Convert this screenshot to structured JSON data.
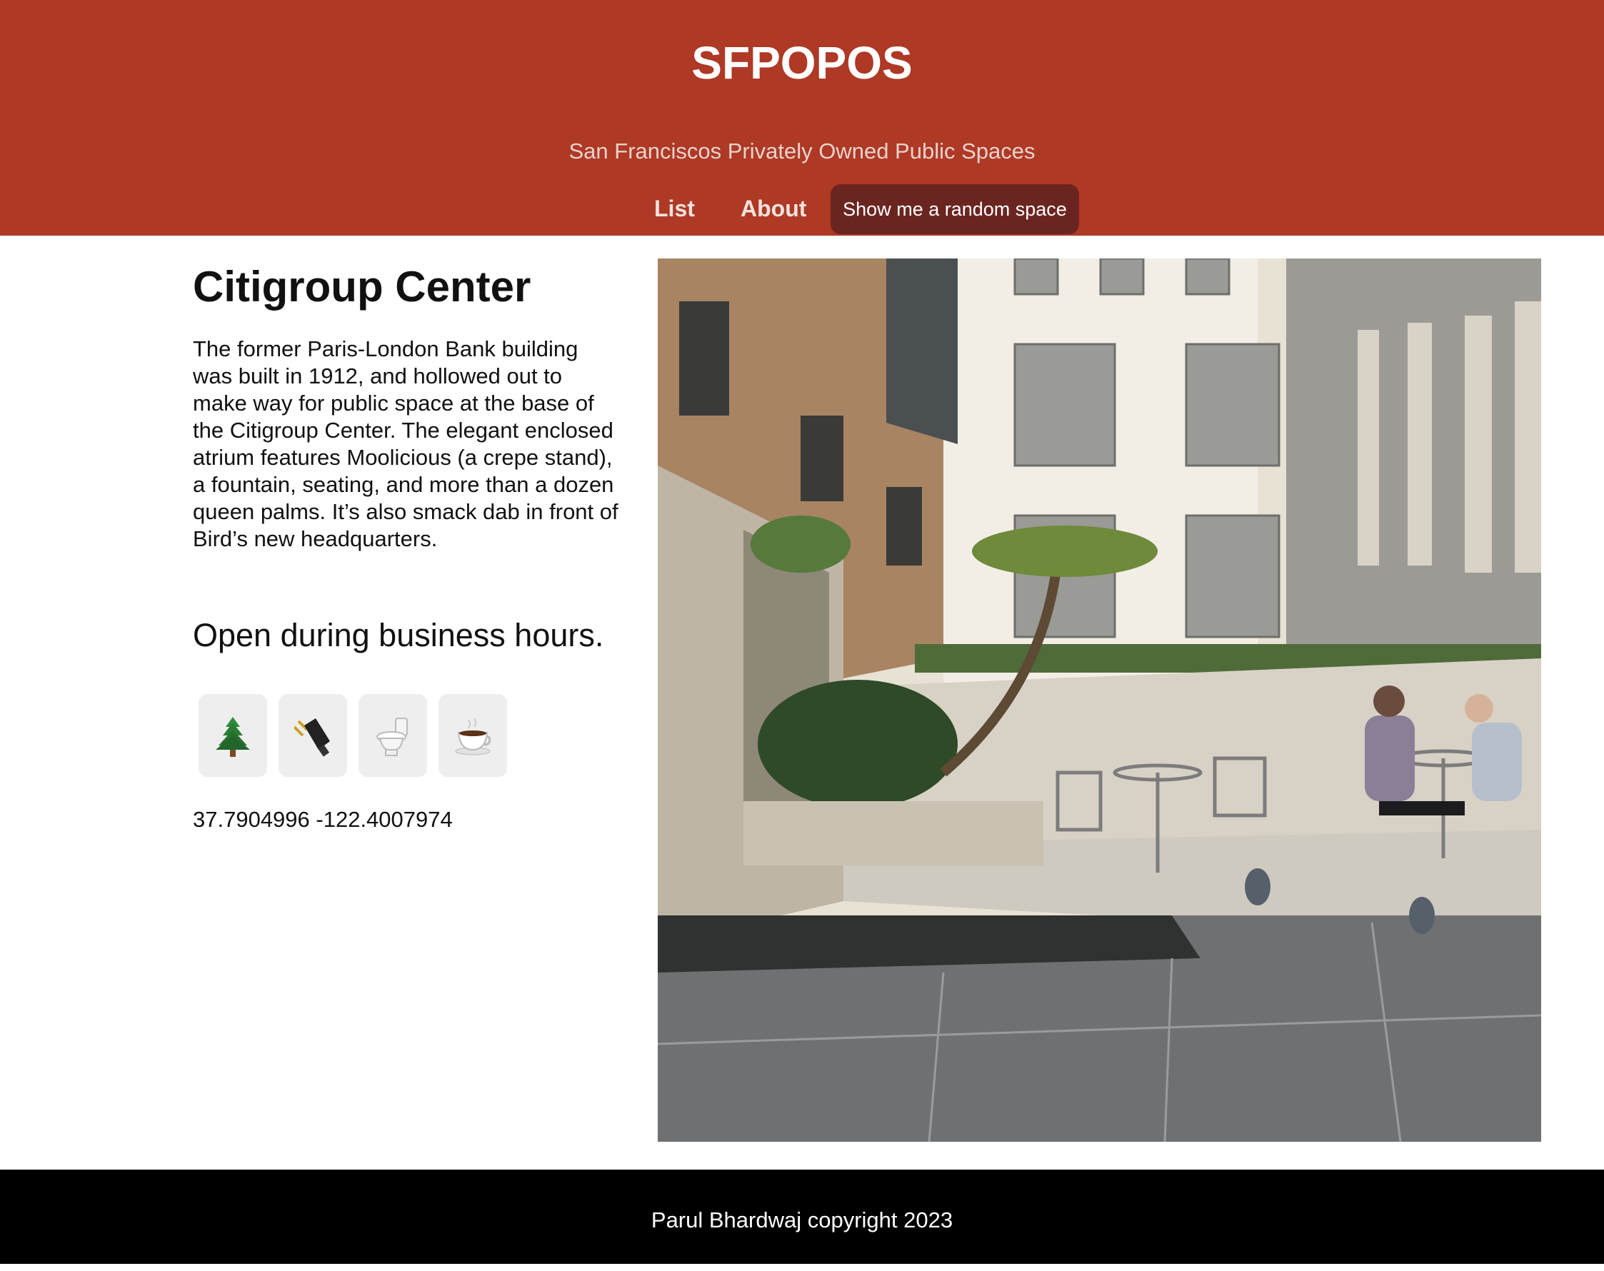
{
  "header": {
    "title": "SFPOPOS",
    "subtitle": "San Franciscos Privately Owned Public Spaces",
    "background_color": "#ae3925"
  },
  "nav": {
    "list_label": "List",
    "about_label": "About",
    "random_button_label": "Show me a random space",
    "random_button_color": "#6b2520"
  },
  "space": {
    "name": "Citigroup Center",
    "description": "The former Paris-London Bank building was built in 1912, and hollowed out to make way for public space at the base of the Citigroup Center. The elegant enclosed atrium features Moolicious (a crepe stand), a fountain, seating, and more than a dozen queen palms. It’s also smack dab in front of Bird’s new headquarters.",
    "hours": "Open during business hours.",
    "amenities": [
      {
        "icon": "tree-icon"
      },
      {
        "icon": "plug-icon"
      },
      {
        "icon": "toilet-icon"
      },
      {
        "icon": "coffee-icon"
      }
    ],
    "coordinates": "37.7904996 -122.4007974",
    "photo_icon": "atrium-photo"
  },
  "footer": {
    "text": "Parul Bhardwaj copyright 2023"
  }
}
